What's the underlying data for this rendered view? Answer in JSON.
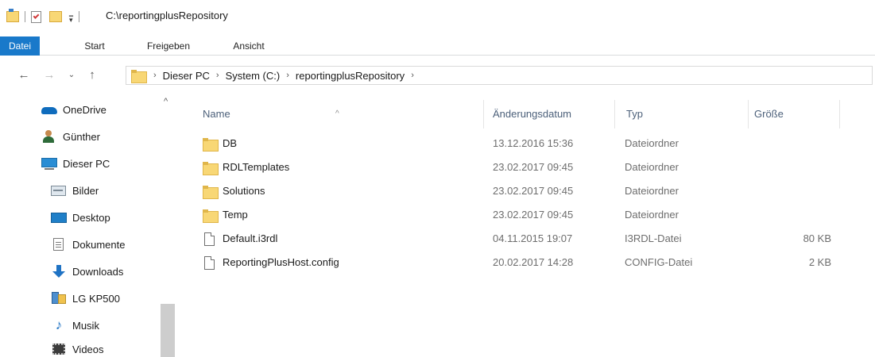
{
  "window": {
    "title": "C:\\reportingplusRepository"
  },
  "ribbon": {
    "tabs": [
      "Datei",
      "Start",
      "Freigeben",
      "Ansicht"
    ]
  },
  "address": {
    "crumbs": [
      "Dieser PC",
      "System (C:)",
      "reportingplusRepository"
    ]
  },
  "sidebar": {
    "items": [
      {
        "label": "OneDrive",
        "icon": "onedrive-icon"
      },
      {
        "label": "Günther",
        "icon": "user-icon"
      },
      {
        "label": "Dieser PC",
        "icon": "pc-icon"
      },
      {
        "label": "Bilder",
        "icon": "pictures-icon"
      },
      {
        "label": "Desktop",
        "icon": "desktop-icon"
      },
      {
        "label": "Dokumente",
        "icon": "documents-icon"
      },
      {
        "label": "Downloads",
        "icon": "downloads-icon"
      },
      {
        "label": "LG KP500",
        "icon": "phone-icon"
      },
      {
        "label": "Musik",
        "icon": "music-icon"
      },
      {
        "label": "Videos",
        "icon": "videos-icon"
      }
    ]
  },
  "columns": [
    "Name",
    "Änderungsdatum",
    "Typ",
    "Größe"
  ],
  "files": [
    {
      "name": "DB",
      "date": "13.12.2016 15:36",
      "type": "Dateiordner",
      "size": "",
      "icon": "folder-icon"
    },
    {
      "name": "RDLTemplates",
      "date": "23.02.2017 09:45",
      "type": "Dateiordner",
      "size": "",
      "icon": "folder-icon"
    },
    {
      "name": "Solutions",
      "date": "23.02.2017 09:45",
      "type": "Dateiordner",
      "size": "",
      "icon": "folder-icon"
    },
    {
      "name": "Temp",
      "date": "23.02.2017 09:45",
      "type": "Dateiordner",
      "size": "",
      "icon": "folder-icon"
    },
    {
      "name": "Default.i3rdl",
      "date": "04.11.2015 19:07",
      "type": "I3RDL-Datei",
      "size": "80 KB",
      "icon": "file-icon"
    },
    {
      "name": "ReportingPlusHost.config",
      "date": "20.02.2017 14:28",
      "type": "CONFIG-Datei",
      "size": "2 KB",
      "icon": "file-icon"
    }
  ],
  "colors": {
    "accent": "#1979ca",
    "folder": "#f8d775",
    "header_text": "#4c607a"
  }
}
